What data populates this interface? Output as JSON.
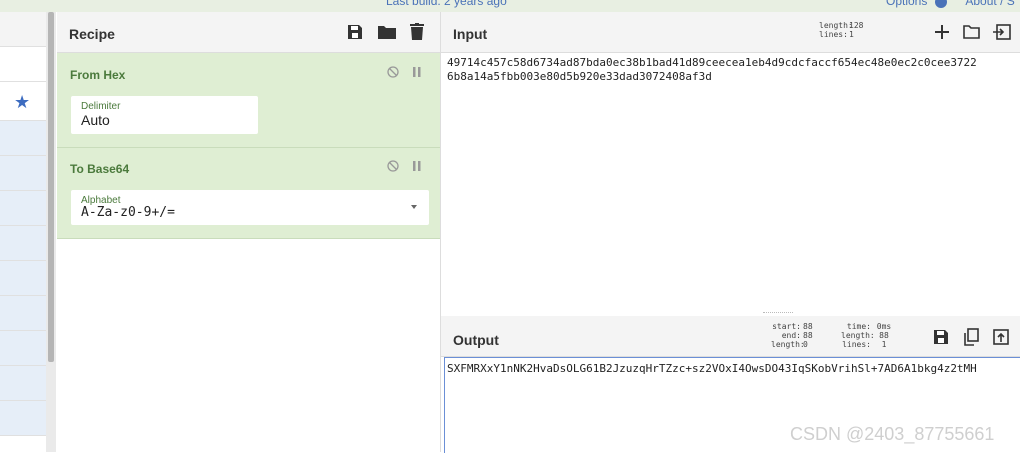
{
  "topbar": {
    "last_build": "Last build: 2 years ago",
    "options": "Options",
    "about": "About / S"
  },
  "recipe": {
    "title": "Recipe",
    "operations": [
      {
        "name": "From Hex",
        "field_label": "Delimiter",
        "field_value": "Auto"
      },
      {
        "name": "To Base64",
        "field_label": "Alphabet",
        "field_value": "A-Za-z0-9+/="
      }
    ]
  },
  "input": {
    "title": "Input",
    "length_label": "length:",
    "length_value": "128",
    "lines_label": "lines:",
    "lines_value": "1",
    "line1": "49714c457c58d6734ad87bda0ec38b1bad41d89ceecea1eb4d9cdcfaccf654ec48e0ec2c0cee3722",
    "line2": "6b8a14a5fbb003e80d5b920e33dad3072408af3d"
  },
  "output": {
    "title": "Output",
    "start_label": "start:",
    "start_value": "88",
    "end_label": "end:",
    "end_value": "88",
    "olength_label": "length:",
    "olength_value": "0",
    "time_label": "time:",
    "time_value": "0ms",
    "length_label": "length:",
    "length_value": "88",
    "lines_label": "lines:",
    "lines_value": "1",
    "text": "SXFMRXxY1nNK2HvaDsOLG61B2JzuzqHrTZzc+sz2VOxI4OwsDO43IqSKobVrihSl+7AD6A1bkg4z2tMH"
  },
  "watermark": "CSDN @2403_87755661",
  "colors": {
    "accent": "#4a72b8",
    "op_bg": "#dfeed3",
    "op_title": "#4b7a3c"
  }
}
